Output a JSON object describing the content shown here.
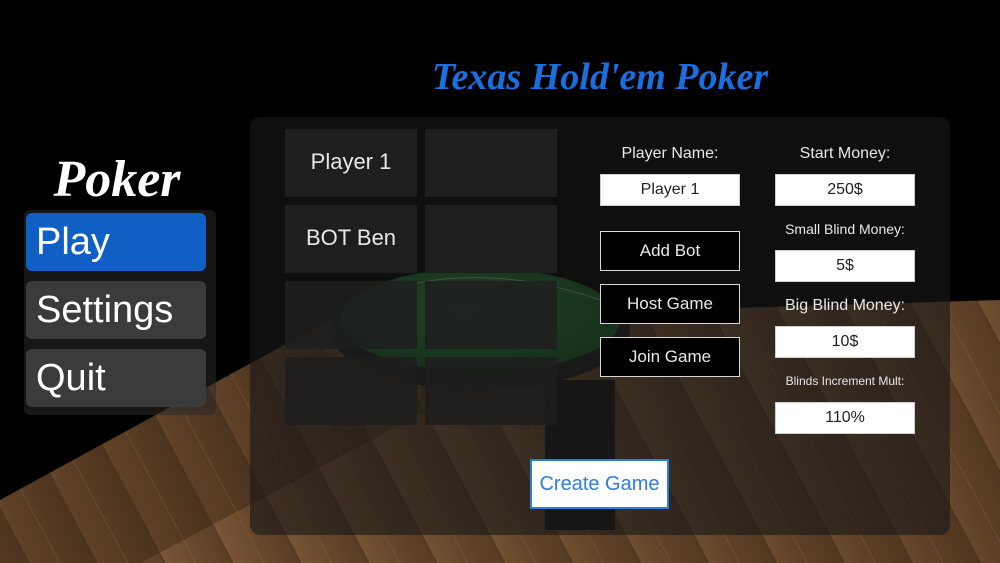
{
  "header": {
    "title": "Texas Hold'em Poker"
  },
  "side_menu": {
    "logo": "Poker",
    "items": [
      {
        "label": "Play",
        "active": true
      },
      {
        "label": "Settings",
        "active": false
      },
      {
        "label": "Quit",
        "active": false
      }
    ]
  },
  "lobby": {
    "player_slots": [
      "Player 1",
      "BOT Ben",
      "",
      "",
      "",
      "",
      "",
      ""
    ]
  },
  "player": {
    "name_label": "Player Name:",
    "name_value": "Player 1",
    "add_bot_label": "Add Bot",
    "host_game_label": "Host Game",
    "join_game_label": "Join Game"
  },
  "settings": {
    "start_money_label": "Start Money:",
    "start_money_value": "250$",
    "small_blind_label": "Small Blind Money:",
    "small_blind_value": "5$",
    "big_blind_label": "Big Blind Money:",
    "big_blind_value": "10$",
    "blinds_increment_label": "Blinds Increment Mult:",
    "blinds_increment_value": "110%"
  },
  "actions": {
    "create_game_label": "Create Game"
  },
  "colors": {
    "accent": "#1a6fe0",
    "active_menu": "#0f5fc4",
    "felt": "#1f6b2a",
    "wood": "#6b4a2c"
  }
}
